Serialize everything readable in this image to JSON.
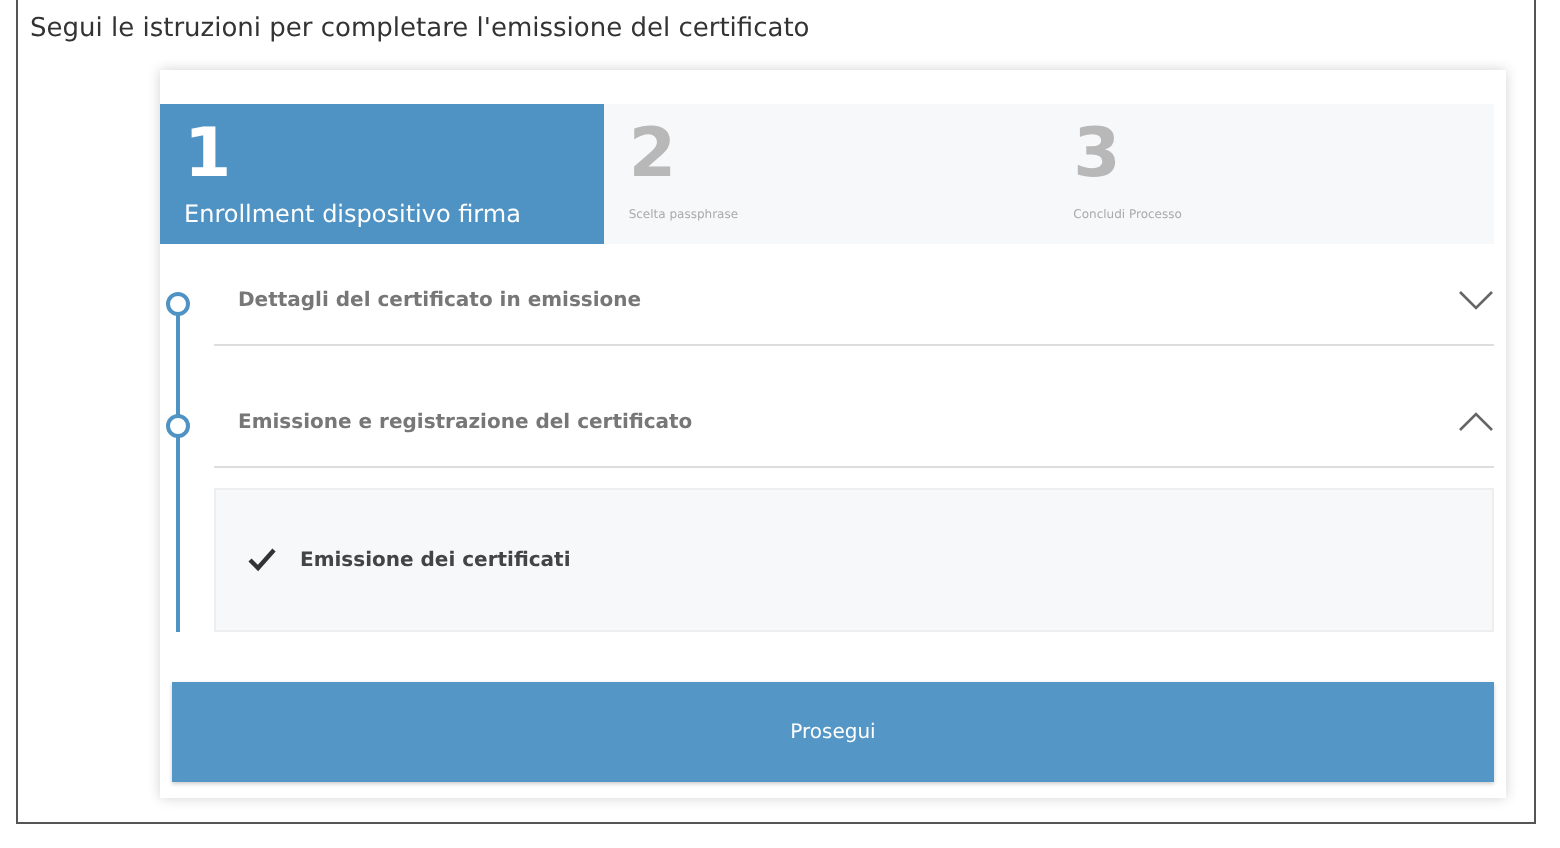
{
  "instruction": "Segui le istruzioni per completare l'emissione del certificato",
  "steps": [
    {
      "number": "1",
      "label": "Enrollment dispositivo firma",
      "selected": true
    },
    {
      "number": "2",
      "label": "Scelta passphrase",
      "selected": false
    },
    {
      "number": "3",
      "label": "Concludi Processo",
      "selected": false
    }
  ],
  "sections": [
    {
      "title": "Dettagli del certificato in emissione",
      "expanded": false
    },
    {
      "title": "Emissione e registrazione del certificato",
      "expanded": true,
      "items": [
        {
          "label": "Emissione dei certificati",
          "checked": true
        }
      ]
    }
  ],
  "button": "Prosegui"
}
